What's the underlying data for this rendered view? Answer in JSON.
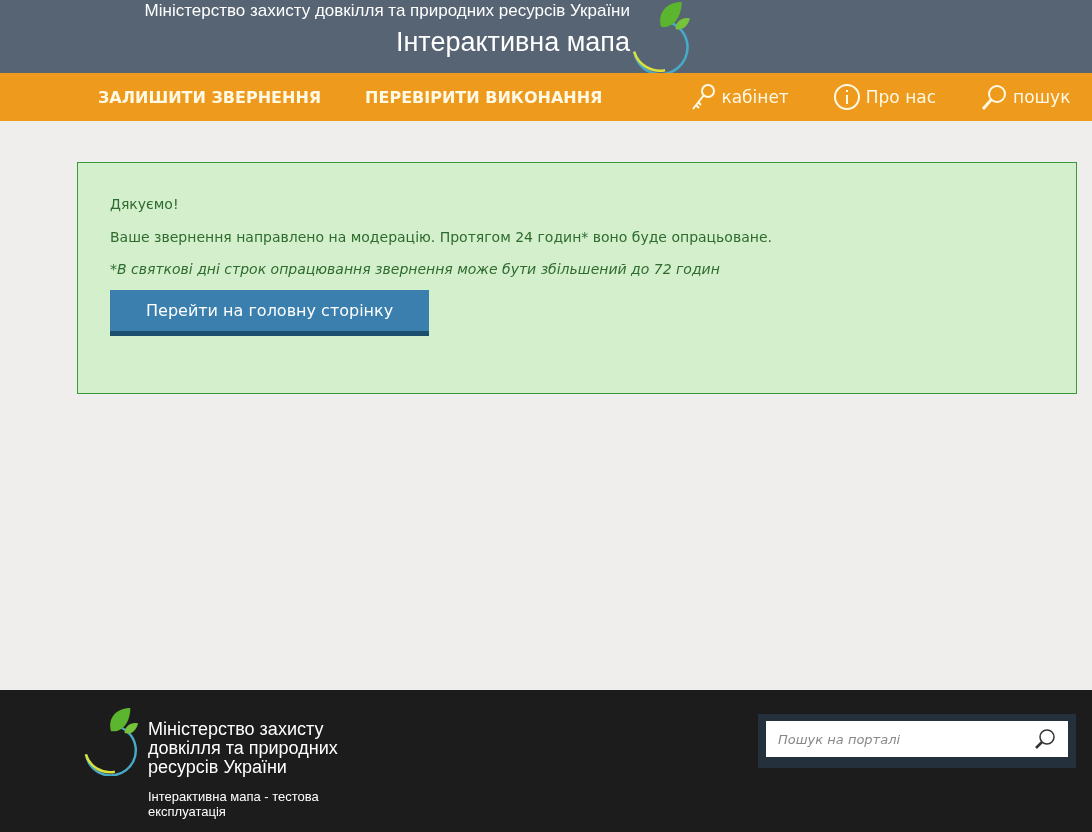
{
  "header": {
    "ministry": "Міністерство захисту довкілля та природних ресурсів України",
    "title": "Інтерактивна мапа"
  },
  "nav": {
    "links": [
      {
        "label": "ЗАЛИШИТИ ЗВЕРНЕННЯ"
      },
      {
        "label": "ПЕРЕВІРИТИ ВИКОНАННЯ"
      }
    ],
    "tools": [
      {
        "kind": "key",
        "label": "кабінет"
      },
      {
        "kind": "info",
        "label": "Про нас"
      },
      {
        "kind": "search",
        "label": "пошук"
      }
    ]
  },
  "alert": {
    "heading": "Дякуємо!",
    "message": "Ваше звернення направлено на модерацію. Протягом 24 годин* воно буде опрацьоване.",
    "note": "*В святкові дні строк опрацювання звернення може бути збільшений до 72 годин",
    "button": "Перейти на головну сторінку"
  },
  "footer": {
    "ministry": "Міністерство захисту довкілля та природних ресурсів України",
    "subtitle": "Інтерактивна мапа - тестова експлуатація",
    "search": {
      "placeholder": "Пошук на порталі"
    }
  }
}
